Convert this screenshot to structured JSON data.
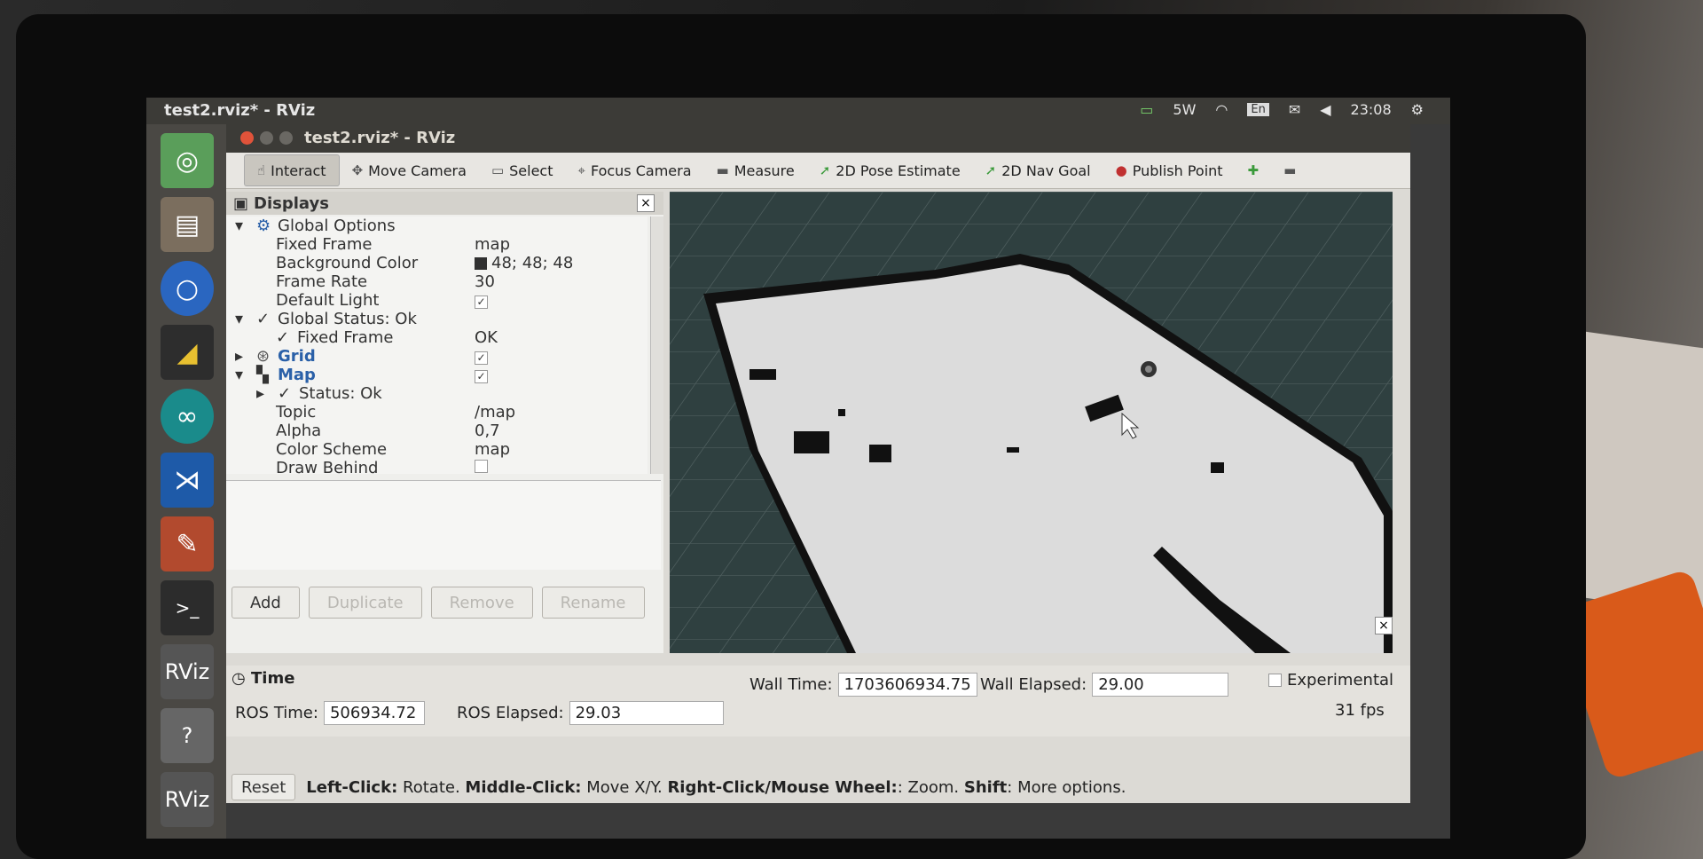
{
  "top_panel": {
    "title": "test2.rviz* - RViz",
    "battery": "5W",
    "keyboard": "En",
    "clock": "23:08"
  },
  "window": {
    "title": "test2.rviz* - RViz"
  },
  "launcher": {
    "items": [
      {
        "icon": "ubuntu-dash-icon"
      },
      {
        "icon": "files-icon"
      },
      {
        "icon": "chromium-icon"
      },
      {
        "icon": "geometry-tool-icon"
      },
      {
        "icon": "arduino-icon"
      },
      {
        "icon": "vscode-icon"
      },
      {
        "icon": "text-editor-icon"
      },
      {
        "icon": "terminal-icon"
      },
      {
        "icon": "rviz-icon",
        "label": "RViz"
      },
      {
        "icon": "help-icon",
        "label": "?"
      },
      {
        "icon": "rviz-icon",
        "label": "RViz"
      }
    ]
  },
  "toolbar": {
    "items": [
      {
        "label": "Interact",
        "icon": "cursor-icon"
      },
      {
        "label": "Move Camera",
        "icon": "move-camera-icon"
      },
      {
        "label": "Select",
        "icon": "select-icon"
      },
      {
        "label": "Focus Camera",
        "icon": "focus-camera-icon"
      },
      {
        "label": "Measure",
        "icon": "ruler-icon"
      },
      {
        "label": "2D Pose Estimate",
        "icon": "pose-arrow-icon"
      },
      {
        "label": "2D Nav Goal",
        "icon": "nav-goal-icon"
      },
      {
        "label": "Publish Point",
        "icon": "pin-icon"
      }
    ]
  },
  "displays": {
    "title": "Displays",
    "global_options": "Global Options",
    "fixed_frame_k": "Fixed Frame",
    "fixed_frame_v": "map",
    "bg_color_k": "Background Color",
    "bg_color_v": "48; 48; 48",
    "frame_rate_k": "Frame Rate",
    "frame_rate_v": "30",
    "default_light_k": "Default Light",
    "default_light_v": "✓",
    "global_status": "Global Status: Ok",
    "fixed_frame_status_k": "Fixed Frame",
    "fixed_frame_status_v": "OK",
    "grid_k": "Grid",
    "grid_v": "✓",
    "map_k": "Map",
    "map_v": "✓",
    "status_ok": "Status: Ok",
    "topic_k": "Topic",
    "topic_v": "/map",
    "alpha_k": "Alpha",
    "alpha_v": "0,7",
    "color_scheme_k": "Color Scheme",
    "color_scheme_v": "map",
    "draw_behind_k": "Draw Behind",
    "buttons": {
      "add": "Add",
      "duplicate": "Duplicate",
      "remove": "Remove",
      "rename": "Rename"
    }
  },
  "time": {
    "title": "Time",
    "ros_time_label": "ROS Time:",
    "ros_time": "506934.72",
    "ros_elapsed_label": "ROS Elapsed:",
    "ros_elapsed": "29.03",
    "wall_time_label": "Wall Time:",
    "wall_time": "1703606934.75",
    "wall_elapsed_label": "Wall Elapsed:",
    "wall_elapsed": "29.00",
    "experimental": "Experimental",
    "fps": "31 fps"
  },
  "status": {
    "reset": "Reset",
    "left_click": "Left-Click:",
    "left_click_desc": "Rotate.",
    "middle_click": "Middle-Click:",
    "middle_click_desc": "Move X/Y.",
    "right_click": "Right-Click/Mouse Wheel:",
    "right_click_desc": ": Zoom.",
    "shift": "Shift",
    "shift_desc": ": More options."
  },
  "colors": {
    "background": "#303030",
    "map_free": "#dcdcdc",
    "map_occupied": "#111111"
  }
}
